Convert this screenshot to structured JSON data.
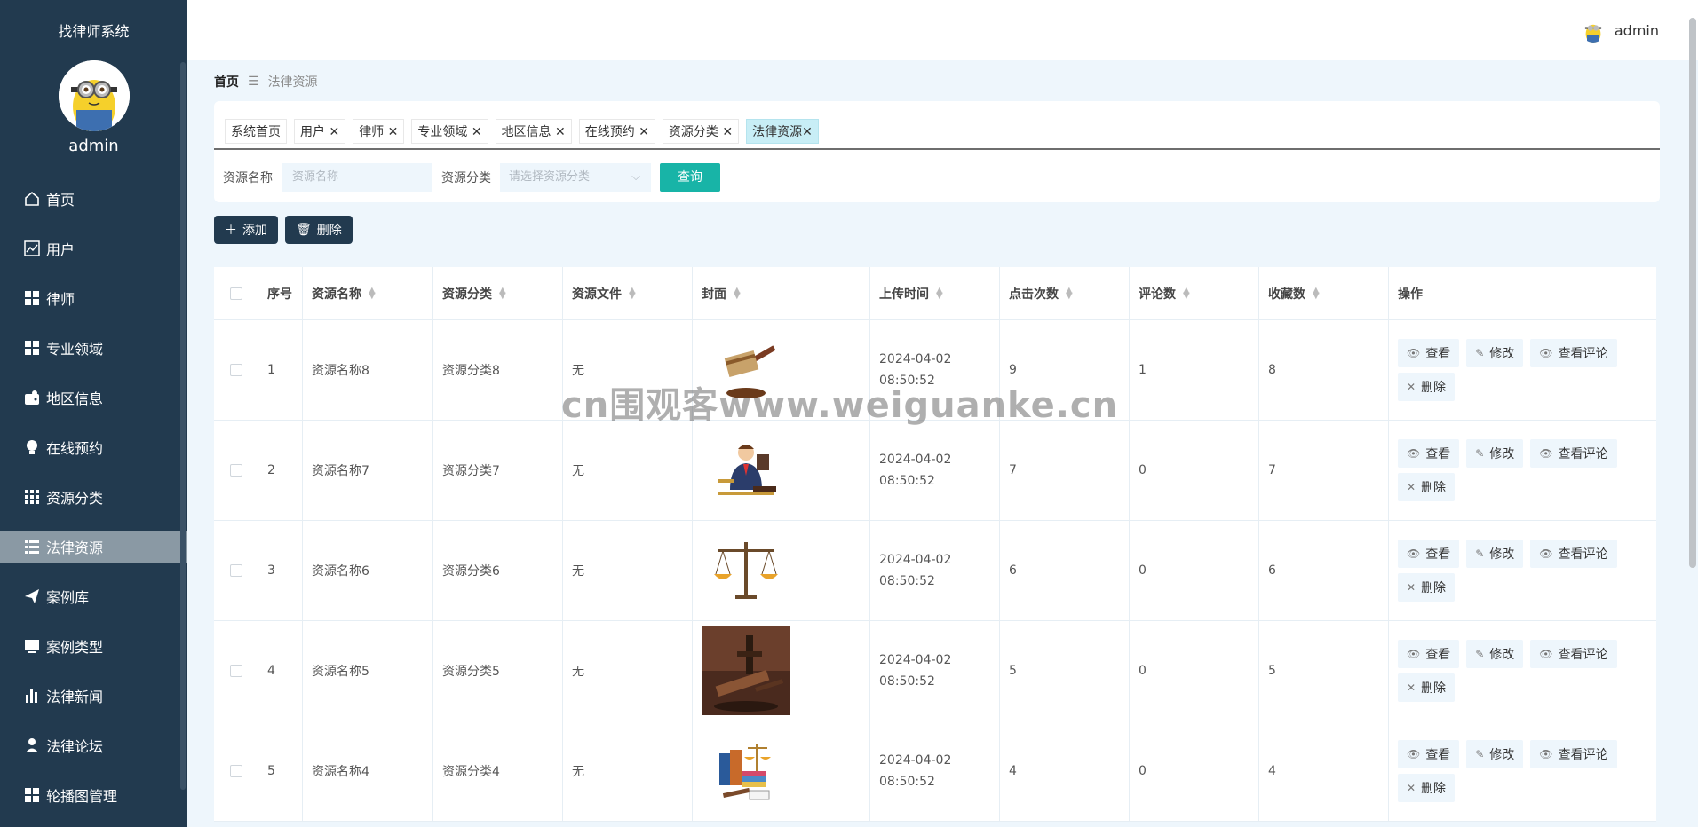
{
  "sidebar": {
    "title": "找律师系统",
    "username": "admin",
    "items": [
      {
        "label": "首页",
        "icon": "home-icon"
      },
      {
        "label": "用户",
        "icon": "chart-icon"
      },
      {
        "label": "律师",
        "icon": "grid-icon"
      },
      {
        "label": "专业领域",
        "icon": "grid-icon"
      },
      {
        "label": "地区信息",
        "icon": "wallet-icon"
      },
      {
        "label": "在线预约",
        "icon": "bulb-icon"
      },
      {
        "label": "资源分类",
        "icon": "apps-icon"
      },
      {
        "label": "法律资源",
        "icon": "list-icon",
        "active": true
      },
      {
        "label": "案例库",
        "icon": "send-icon"
      },
      {
        "label": "案例类型",
        "icon": "monitor-icon"
      },
      {
        "label": "法律新闻",
        "icon": "bar-chart-icon"
      },
      {
        "label": "法律论坛",
        "icon": "person-icon"
      },
      {
        "label": "轮播图管理",
        "icon": "grid-icon"
      }
    ]
  },
  "topbar": {
    "username": "admin"
  },
  "breadcrumb": {
    "home": "首页",
    "sep": "☰",
    "current": "法律资源"
  },
  "tabs": [
    {
      "label": "系统首页",
      "closable": false
    },
    {
      "label": "用户",
      "closable": true
    },
    {
      "label": "律师",
      "closable": true
    },
    {
      "label": "专业领域",
      "closable": true
    },
    {
      "label": "地区信息",
      "closable": true
    },
    {
      "label": "在线预约",
      "closable": true
    },
    {
      "label": "资源分类",
      "closable": true
    },
    {
      "label": "法律资源",
      "closable": true,
      "active": true
    }
  ],
  "search": {
    "name_label": "资源名称",
    "name_placeholder": "资源名称",
    "category_label": "资源分类",
    "category_placeholder": "请选择资源分类",
    "query_button": "查询"
  },
  "actions": {
    "add": "添加",
    "delete": "删除"
  },
  "table": {
    "headers": [
      "序号",
      "资源名称",
      "资源分类",
      "资源文件",
      "封面",
      "上传时间",
      "点击次数",
      "评论数",
      "收藏数",
      "操作"
    ],
    "op_labels": {
      "view": "查看",
      "edit": "修改",
      "view_comments": "查看评论",
      "delete": "删除"
    },
    "rows": [
      {
        "no": "1",
        "name": "资源名称8",
        "category": "资源分类8",
        "file": "无",
        "cover": "gavel",
        "time": "2024-04-02 08:50:52",
        "clicks": "9",
        "comments": "1",
        "favorites": "8"
      },
      {
        "no": "2",
        "name": "资源名称7",
        "category": "资源分类7",
        "file": "无",
        "cover": "lawyer",
        "time": "2024-04-02 08:50:52",
        "clicks": "7",
        "comments": "0",
        "favorites": "7"
      },
      {
        "no": "3",
        "name": "资源名称6",
        "category": "资源分类6",
        "file": "无",
        "cover": "scales",
        "time": "2024-04-02 08:50:52",
        "clicks": "6",
        "comments": "0",
        "favorites": "6"
      },
      {
        "no": "4",
        "name": "资源名称5",
        "category": "资源分类5",
        "file": "无",
        "cover": "gavel-photo",
        "time": "2024-04-02 08:50:52",
        "clicks": "5",
        "comments": "0",
        "favorites": "5"
      },
      {
        "no": "5",
        "name": "资源名称4",
        "category": "资源分类4",
        "file": "无",
        "cover": "books",
        "time": "2024-04-02 08:50:52",
        "clicks": "4",
        "comments": "0",
        "favorites": "4"
      }
    ]
  },
  "watermark": "cn围观客www.weiguanke.cn",
  "colors": {
    "sidebar_bg": "#223a4f",
    "accent": "#18b4a7",
    "active_tab": "#c8eef6"
  }
}
